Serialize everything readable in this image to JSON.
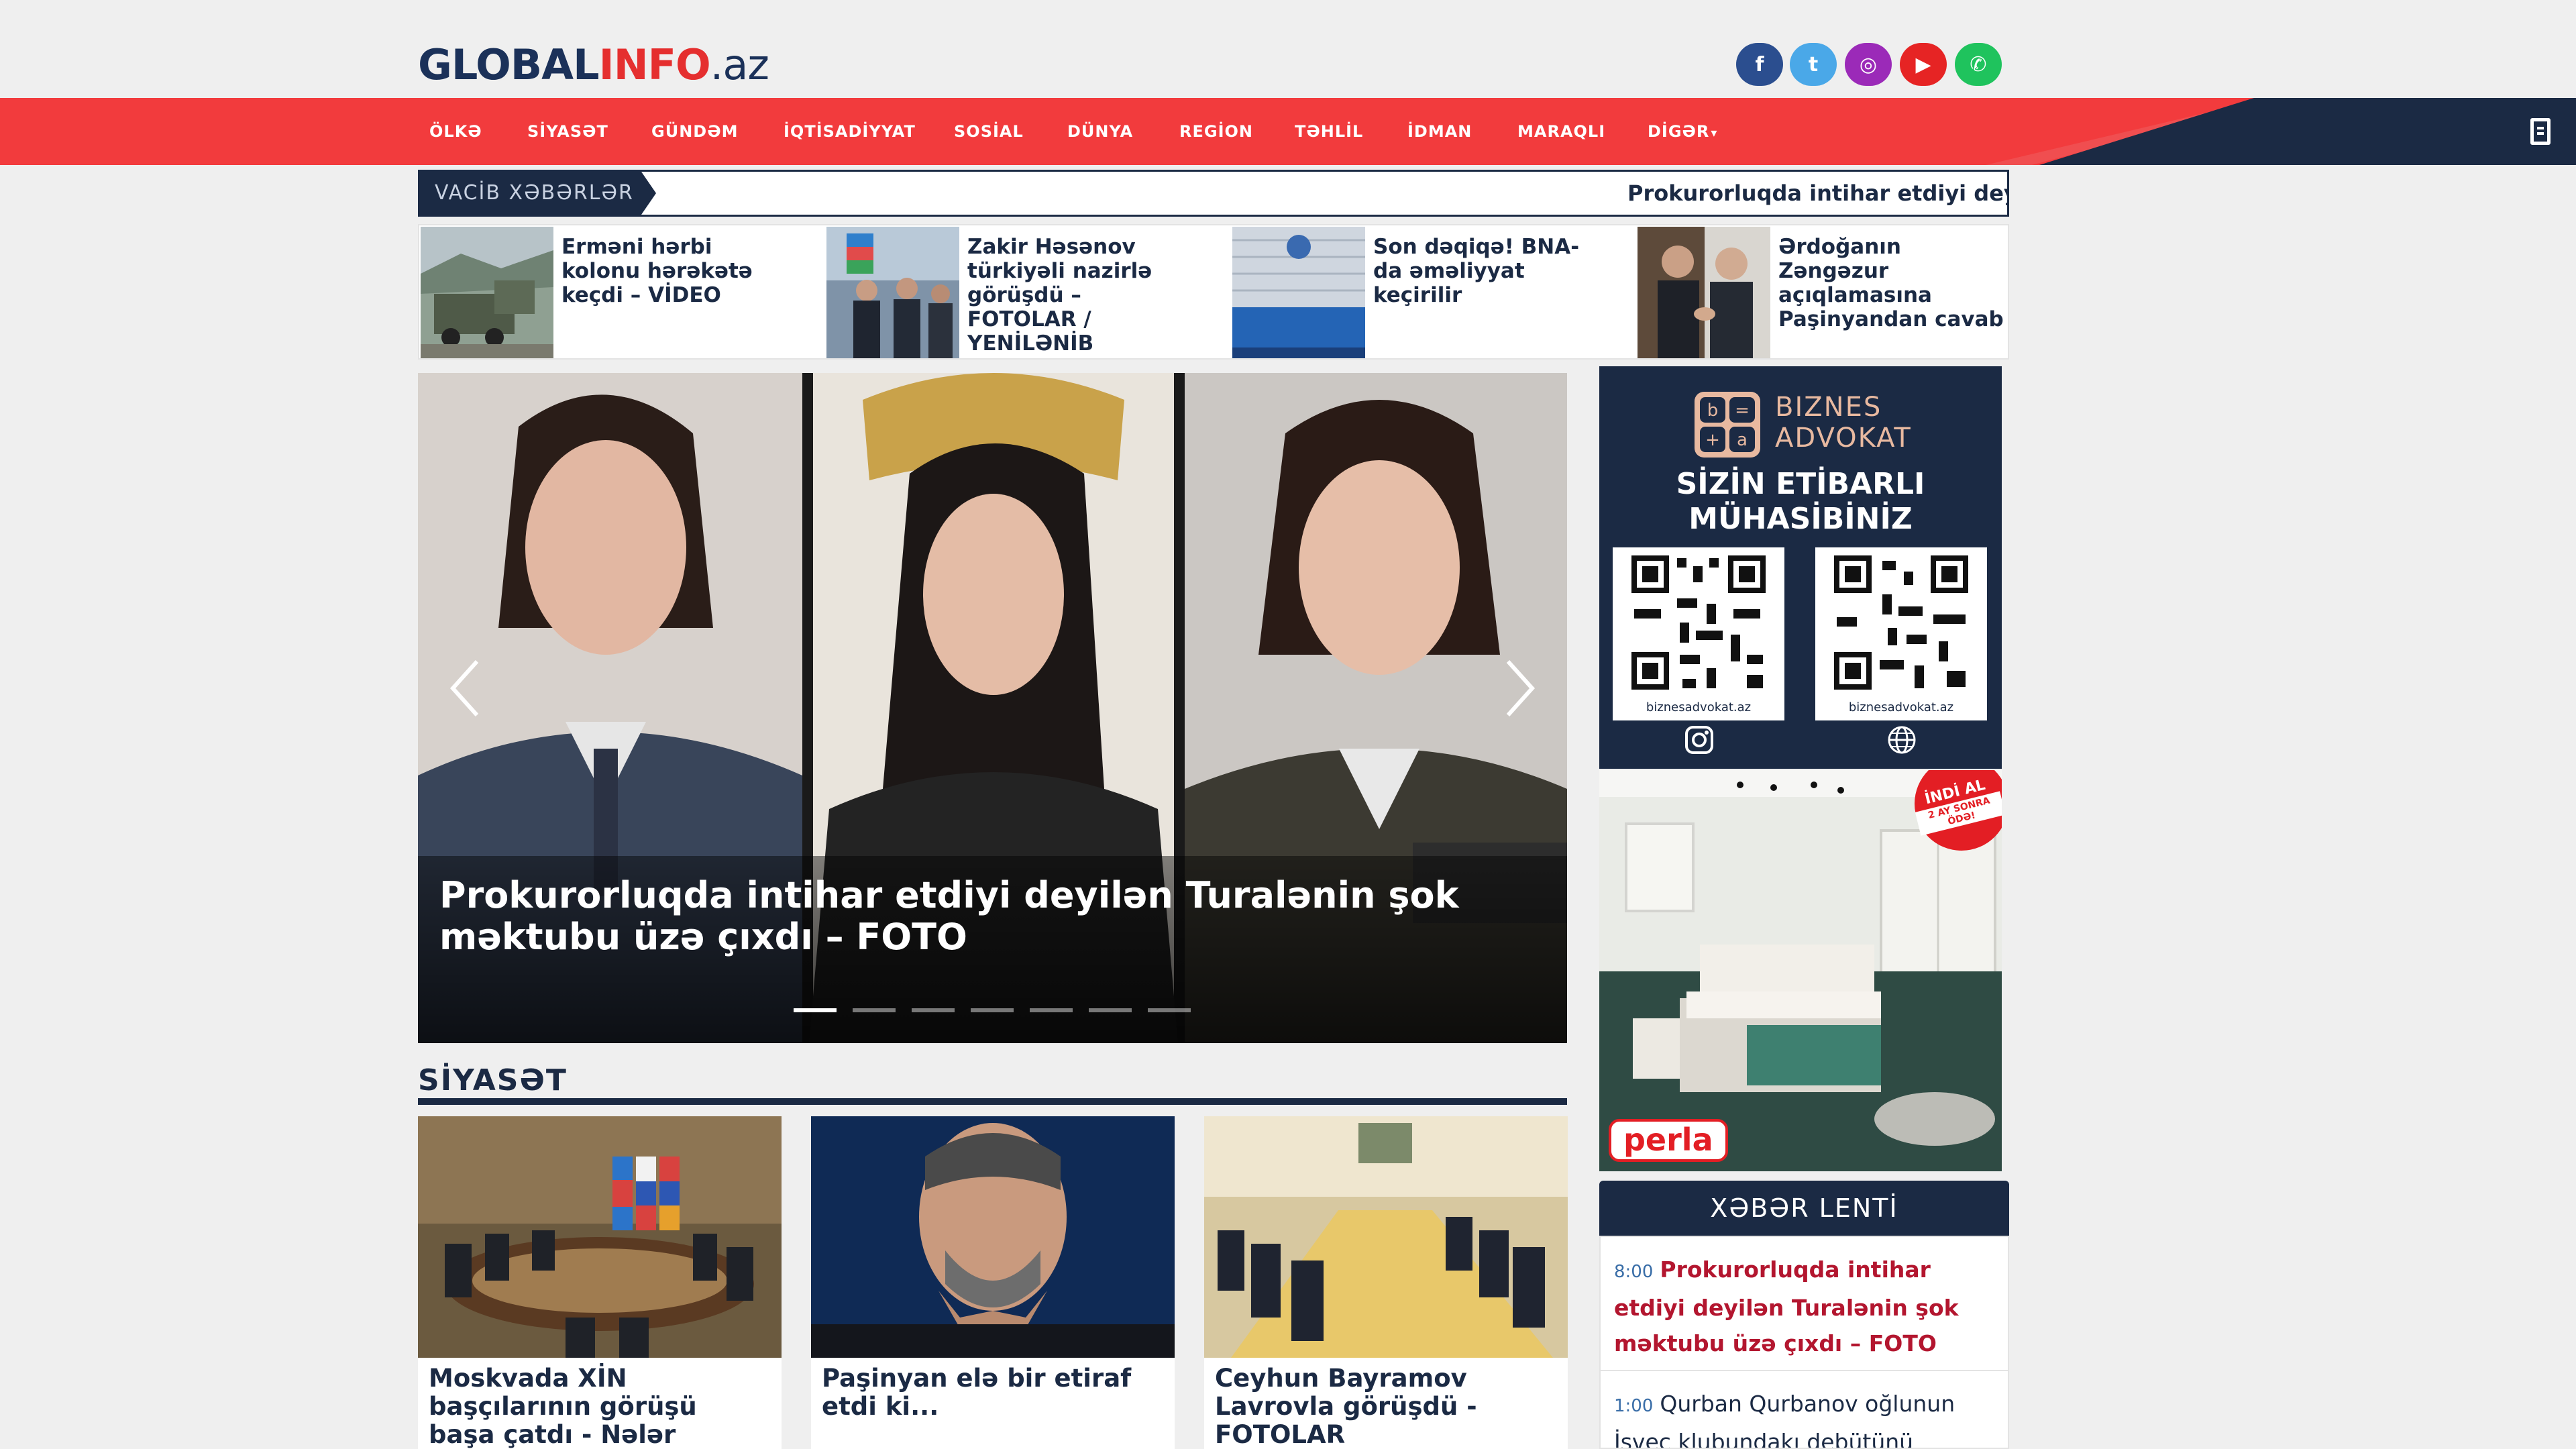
{
  "header": {
    "logo": {
      "part1": "GLOBAL",
      "part2": "INFO",
      "part3": ".az"
    },
    "social": [
      {
        "icon": "facebook-icon",
        "glyph": "f",
        "color": "#2b4e8f"
      },
      {
        "icon": "twitter-icon",
        "glyph": "t",
        "color": "#4aa8e8"
      },
      {
        "icon": "instagram-icon",
        "glyph": "◎",
        "color": "#9b2ab8"
      },
      {
        "icon": "youtube-icon",
        "glyph": "▶",
        "color": "#e62424"
      },
      {
        "icon": "whatsapp-icon",
        "glyph": "✆",
        "color": "#1fc35d"
      }
    ]
  },
  "nav": {
    "items": [
      "ÖLKƏ",
      "SİYASƏT",
      "GÜNDƏM",
      "İQTİSADİYYAT",
      "SOSİAL",
      "DÜNYA",
      "REGİON",
      "TƏHLİL",
      "İDMAN",
      "MARAQLI",
      "DİGƏR"
    ],
    "dropdown_glyph": "▾"
  },
  "breaking": {
    "label": "VACİB XƏBƏRLƏR",
    "text": "Prokurorluqda intihar etdiyi deyilən Turalənin şok məktubu üzə çıxdı – FOTO"
  },
  "top_stories": [
    {
      "title": "Erməni hərbi kolonu hərəkətə keçdi – VİDEO"
    },
    {
      "title": "Zakir Həsənov türkiyəli nazirlə görüşdü – FOTOLAR / YENİLƏNİB"
    },
    {
      "title": "Son dəqiqə! BNA-da əməliyyat keçirilir"
    },
    {
      "title": "Ərdoğanın Zəngəzur açıqlamasına Paşinyandan cavab"
    }
  ],
  "slider": {
    "caption": "Prokurorluqda intihar etdiyi deyilən Turalənin şok məktubu üzə çıxdı – FOTO",
    "slide_count": 7,
    "active_slide": 1
  },
  "section": {
    "title": "SİYASƏT",
    "cards": [
      {
        "title": "Moskvada XİN başçılarının görüşü başa çatdı - Nələr müzakirə edildi? - VİDEO/"
      },
      {
        "title": "Paşinyan elə bir etiraf etdi ki..."
      },
      {
        "title": "Ceyhun Bayramov Lavrovla görüşdü - FOTOLAR"
      }
    ]
  },
  "ads": {
    "ad1": {
      "brand": [
        "BIZNES",
        "ADVOKAT"
      ],
      "headline": [
        "SİZİN ETİBARLI",
        "MÜHASİBİNİZ"
      ],
      "qr_caption": "biznesadvokat.az"
    },
    "ad2": {
      "badge_top": "İNDİ AL",
      "badge_bottom": "2 AY SONRA ÖDƏ!",
      "brand": "perla"
    }
  },
  "feed": {
    "title": "XƏBƏR LENTİ",
    "items": [
      {
        "time": "8:00",
        "title": "Prokurorluqda intihar etdiyi deyilən Turalənin şok məktubu üzə çıxdı – FOTO"
      },
      {
        "time": "1:00",
        "title": "Qurban Qurbanov oğlunun İsveç klubundakı debütünü"
      }
    ]
  }
}
